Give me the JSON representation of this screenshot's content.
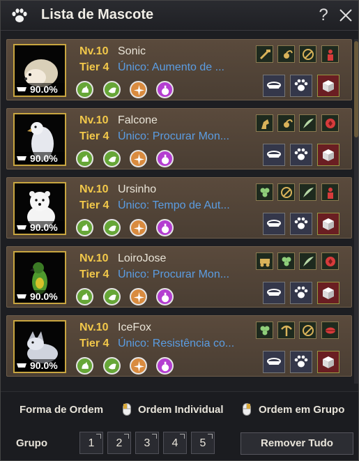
{
  "window": {
    "title": "Lista de Mascote",
    "help_label": "?"
  },
  "pets": [
    {
      "level": "Nv.10",
      "tier": "Tier 4",
      "name": "Sonic",
      "unique_skill": "Único: Aumento de ...",
      "hunger": "90.0%",
      "animal": "hedgehog",
      "traits": [
        "hammer-trait-icon",
        "scorpion-trait-icon",
        "axe-trait-icon",
        "figure-trait-icon"
      ]
    },
    {
      "level": "Nv.10",
      "tier": "Tier 4",
      "name": "Falcone",
      "unique_skill": "Único: Procurar Mon...",
      "hunger": "90.0%",
      "animal": "falcon",
      "traits": [
        "horse-trait-icon",
        "scorpion-trait-icon",
        "wing-trait-icon",
        "shield-trait-icon"
      ]
    },
    {
      "level": "Nv.10",
      "tier": "Tier 4",
      "name": "Ursinho",
      "unique_skill": "Único: Tempo de Aut...",
      "hunger": "90.0%",
      "animal": "bear",
      "traits": [
        "clover-trait-icon",
        "axe-trait-icon",
        "wing-trait-icon",
        "figure-trait-icon"
      ]
    },
    {
      "level": "Nv.10",
      "tier": "Tier 4",
      "name": "LoiroJose",
      "unique_skill": "Único: Procurar Mon...",
      "hunger": "90.0%",
      "animal": "parrot",
      "traits": [
        "cart-trait-icon",
        "clover-trait-icon",
        "wing-trait-icon",
        "shield-trait-icon"
      ]
    },
    {
      "level": "Nv.10",
      "tier": "Tier 4",
      "name": "IceFox",
      "unique_skill": "Único: Resistência co...",
      "hunger": "90.0%",
      "animal": "fox",
      "traits": [
        "clover-trait-icon",
        "pickaxe-trait-icon",
        "axe-trait-icon",
        "lips-trait-icon"
      ]
    }
  ],
  "footer": {
    "order_form_label": "Forma de Ordem",
    "individual_order_label": "Ordem Individual",
    "group_order_label": "Ordem em Grupo",
    "group_label": "Grupo",
    "groups": [
      "1",
      "2",
      "3",
      "4",
      "5"
    ],
    "remove_all_label": "Remover Tudo"
  },
  "colors": {
    "level_text": "#f2c84a",
    "unique_text": "#5b9de2",
    "skill_green": "#66a637",
    "skill_orange": "#d98b3f",
    "skill_purple": "#b43ed1",
    "card_bg": "#5a4a3c",
    "portrait_border": "#c9a640"
  }
}
